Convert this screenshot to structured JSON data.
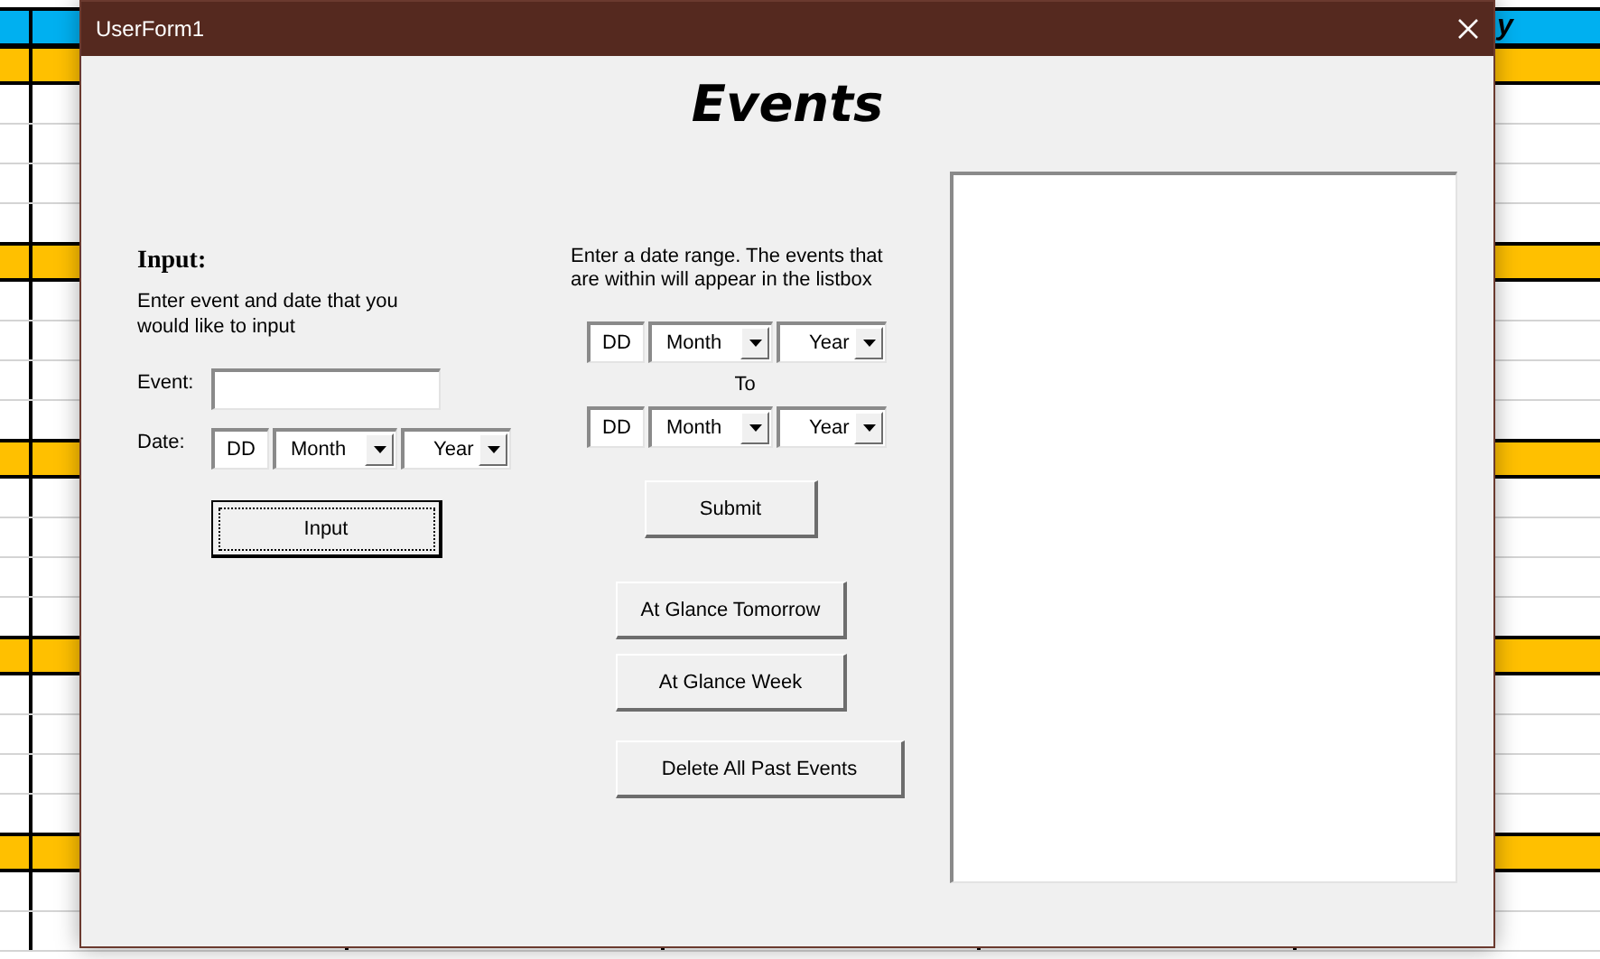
{
  "sheet": {
    "header_fragment": "y",
    "rows": [
      {
        "kind": "header"
      },
      {
        "kind": "band"
      },
      {
        "kind": "plain"
      },
      {
        "kind": "plain"
      },
      {
        "kind": "plain"
      },
      {
        "kind": "plain"
      },
      {
        "kind": "band"
      },
      {
        "kind": "plain"
      },
      {
        "kind": "plain"
      },
      {
        "kind": "plain"
      },
      {
        "kind": "plain"
      },
      {
        "kind": "band"
      },
      {
        "kind": "plain"
      },
      {
        "kind": "plain"
      },
      {
        "kind": "plain"
      },
      {
        "kind": "plain"
      },
      {
        "kind": "band"
      },
      {
        "kind": "plain"
      },
      {
        "kind": "plain"
      },
      {
        "kind": "plain"
      },
      {
        "kind": "plain"
      },
      {
        "kind": "band"
      },
      {
        "kind": "plain"
      },
      {
        "kind": "plain"
      }
    ]
  },
  "window": {
    "title": "UserForm1"
  },
  "heading": "Events",
  "input_section": {
    "title": "Input:",
    "description": "Enter event and date that you would like to input",
    "event": {
      "label": "Event:"
    },
    "date": {
      "label": "Date:",
      "day": "DD",
      "month": "Month",
      "year": "Year"
    },
    "button": {
      "label": "Input",
      "default": true
    }
  },
  "range_section": {
    "description": "Enter a date range. The events that are within will appear in the listbox",
    "from": {
      "day": "DD",
      "month": "Month",
      "year": "Year"
    },
    "separator": "To",
    "to": {
      "day": "DD",
      "month": "Month",
      "year": "Year"
    },
    "submit": "Submit",
    "buttons": [
      {
        "label": "At Glance Tomorrow"
      },
      {
        "label": "At Glance Week"
      },
      {
        "label": "Delete All Past Events"
      }
    ]
  }
}
